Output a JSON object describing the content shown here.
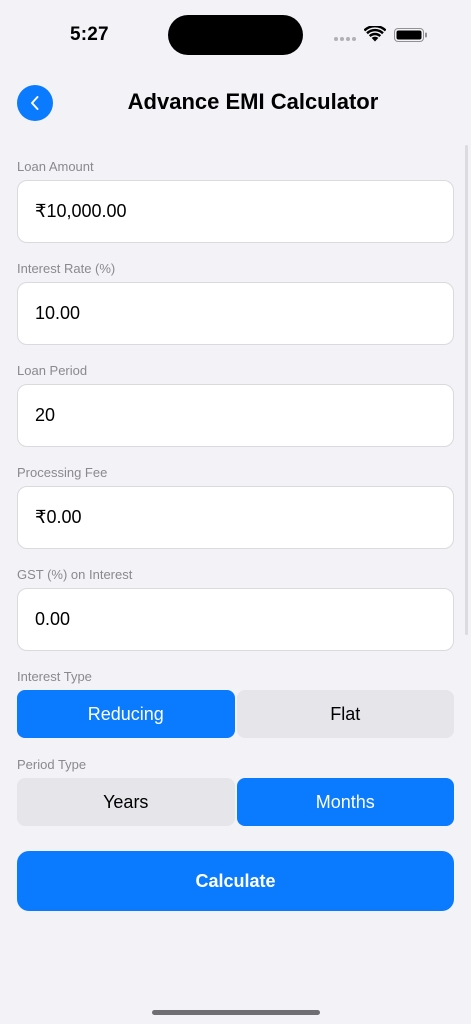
{
  "status_bar": {
    "time": "5:27"
  },
  "header": {
    "title": "Advance EMI Calculator",
    "back_icon": "chevron-left-icon"
  },
  "fields": {
    "loan_amount": {
      "label": "Loan Amount",
      "value": "₹10,000.00"
    },
    "interest_rate": {
      "label": "Interest Rate (%)",
      "value": "10.00"
    },
    "loan_period": {
      "label": "Loan Period",
      "value": "20"
    },
    "processing_fee": {
      "label": "Processing Fee",
      "value": "₹0.00"
    },
    "gst_on_interest": {
      "label": "GST (%) on Interest",
      "value": "0.00"
    }
  },
  "interest_type": {
    "label": "Interest Type",
    "options": [
      "Reducing",
      "Flat"
    ],
    "selected": "Reducing"
  },
  "period_type": {
    "label": "Period Type",
    "options": [
      "Years",
      "Months"
    ],
    "selected": "Months"
  },
  "actions": {
    "calculate_label": "Calculate"
  },
  "colors": {
    "accent": "#0a7aff",
    "background": "#f2f2f7",
    "segment_inactive": "#e5e5ea"
  }
}
